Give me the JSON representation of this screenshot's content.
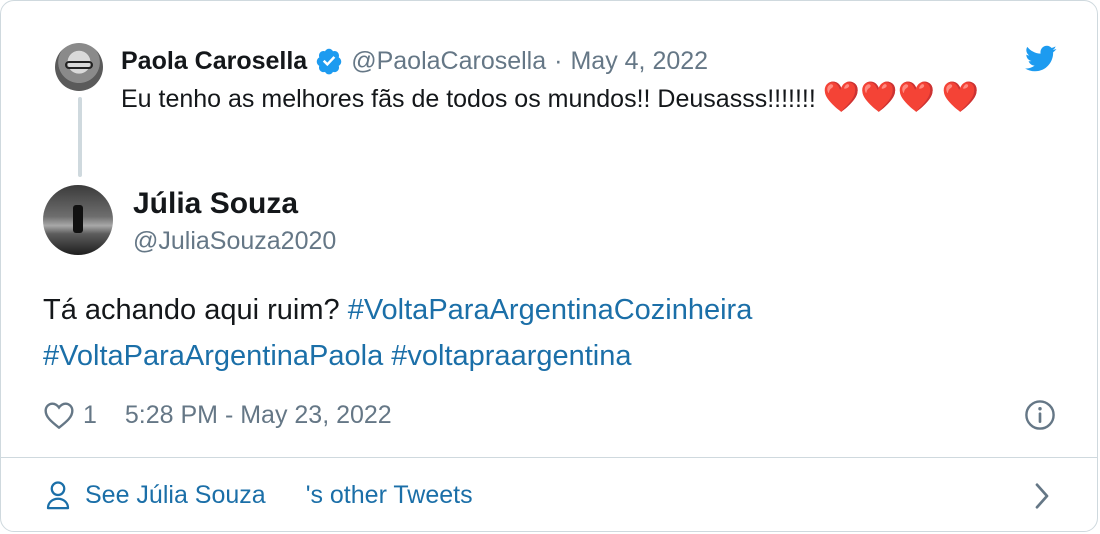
{
  "colors": {
    "link": "#1b6fa8",
    "secondary_text": "#657786",
    "primary_text": "#14171a",
    "twitter_blue": "#1d9bf0",
    "heart_red": "#dd2e44",
    "border": "#cfd9de"
  },
  "parent_tweet": {
    "name": "Paola Carosella",
    "handle": "@PaolaCarosella",
    "separator": "·",
    "date": "May 4, 2022",
    "text": "Eu tenho as melhores fãs de todos os mundos!! Deusasss!!!!!!!",
    "emojis": [
      "❤️",
      "❤️",
      "❤️",
      "❤️"
    ],
    "verified_icon": "verified-badge-icon",
    "bird_icon": "twitter-bird-icon"
  },
  "tweet": {
    "author_name": "Júlia Souza",
    "author_handle": "@JuliaSouza2020",
    "text_prefix": "Tá achando aqui ruim? ",
    "hashtags": [
      "#VoltaParaArgentinaCozinheira",
      "#VoltaParaArgentinaPaola",
      "#voltapraargentina"
    ],
    "like_count": "1",
    "timestamp": "5:28 PM - May 23, 2022"
  },
  "footer": {
    "see_label": "See Júlia Souza",
    "suffix": "'s other Tweets"
  }
}
